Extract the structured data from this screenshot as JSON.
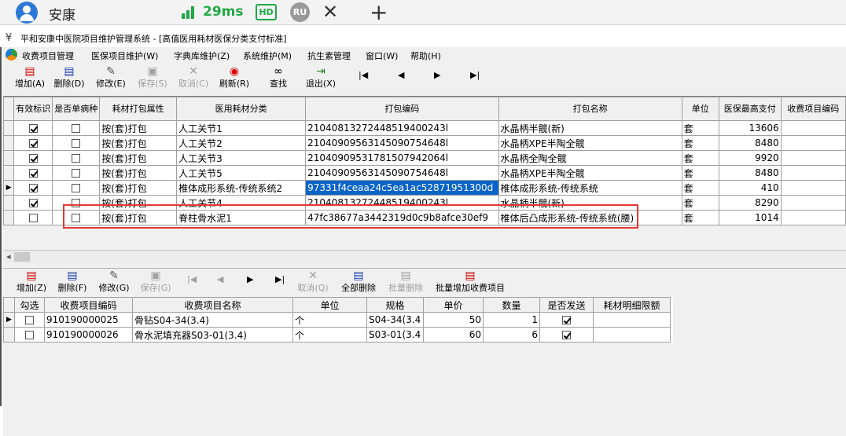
{
  "session": {
    "user": "安康",
    "ping": "29ms",
    "hd_badge": "HD",
    "ru_badge": "RU",
    "close_glyph": "✕",
    "new_tab_glyph": "+"
  },
  "window": {
    "title": "平和安康中医院项目维护管理系统 - [高值医用耗材医保分类支付标准]"
  },
  "menu": {
    "items": [
      "收费项目管理",
      "医保项目维护(W)",
      "字典库维护(Z)",
      "系统维护(M)",
      "抗生素管理",
      "窗口(W)",
      "帮助(H)"
    ]
  },
  "toolbar": {
    "buttons": [
      {
        "label": "增加(A)",
        "icon": "add-icon",
        "enabled": true
      },
      {
        "label": "删除(D)",
        "icon": "delete-icon",
        "enabled": true
      },
      {
        "label": "修改(E)",
        "icon": "edit-icon",
        "enabled": true
      },
      {
        "label": "保存(S)",
        "icon": "save-icon",
        "enabled": false
      },
      {
        "label": "取消(C)",
        "icon": "cancel-icon",
        "enabled": false
      },
      {
        "label": "刷新(R)",
        "icon": "refresh-icon",
        "enabled": true
      },
      {
        "label": "查找",
        "icon": "binoculars-icon",
        "enabled": true
      },
      {
        "label": "退出(X)",
        "icon": "exit-icon",
        "enabled": true
      }
    ],
    "nav": [
      "|◀",
      "◀",
      "▶",
      "▶|"
    ]
  },
  "grid1": {
    "columns": [
      "有效标识",
      "是否单病种",
      "耗材打包属性",
      "医用耗材分类",
      "打包编码",
      "打包名称",
      "单位",
      "医保最高支付",
      "收费项目编码"
    ],
    "rows": [
      {
        "valid": true,
        "single": false,
        "attr": "按(套)打包",
        "category": "人工关节1",
        "code": "21040813272448519400243l",
        "name": "水晶柄半髋(新)",
        "unit": "套",
        "max_pay": "13606",
        "fee_code": ""
      },
      {
        "valid": true,
        "single": false,
        "attr": "按(套)打包",
        "category": "人工关节2",
        "code": "21040909563145090754648l",
        "name": "水晶柄XPE半陶全髋",
        "unit": "套",
        "max_pay": "8480",
        "fee_code": ""
      },
      {
        "valid": true,
        "single": false,
        "attr": "按(套)打包",
        "category": "人工关节3",
        "code": "21040909531781507942064l",
        "name": "水晶柄全陶全髋",
        "unit": "套",
        "max_pay": "9920",
        "fee_code": ""
      },
      {
        "valid": true,
        "single": false,
        "attr": "按(套)打包",
        "category": "人工关节5",
        "code": "21040909563145090754648l",
        "name": "水晶柄XPE半陶全髋",
        "unit": "套",
        "max_pay": "8480",
        "fee_code": ""
      },
      {
        "valid": true,
        "single": false,
        "attr": "按(套)打包",
        "category": "椎体成形系统-传统系统2",
        "code": "97331f4ceaa24c5ea1ac52871951300d",
        "name": "椎体成形系统-传统系统",
        "unit": "套",
        "max_pay": "410",
        "fee_code": "",
        "current": true
      },
      {
        "valid": true,
        "single": false,
        "attr": "按(套)打包",
        "category": "人工关节4",
        "code": "21040813272448519400243l",
        "name": "水晶柄半髋(新)",
        "unit": "套",
        "max_pay": "8290",
        "fee_code": ""
      },
      {
        "valid": false,
        "single": false,
        "attr": "按(套)打包",
        "category": "脊柱骨水泥1",
        "code": "47fc38677a3442319d0c9b8afce30ef9",
        "name": "椎体后凸成形系统-传统系统(腰)",
        "unit": "套",
        "max_pay": "1014",
        "fee_code": ""
      }
    ]
  },
  "toolbar2": {
    "buttons": [
      {
        "label": "增加(Z)",
        "icon": "add-icon",
        "enabled": true
      },
      {
        "label": "删除(F)",
        "icon": "delete-icon",
        "enabled": true
      },
      {
        "label": "修改(G)",
        "icon": "edit-icon",
        "enabled": true
      },
      {
        "label": "保存(G)",
        "icon": "save-icon",
        "enabled": false
      },
      {
        "label": "取消(Q)",
        "icon": "cancel-icon",
        "enabled": false
      },
      {
        "label": "全部删除",
        "icon": "delete-all-icon",
        "enabled": true
      },
      {
        "label": "批量删除",
        "icon": "batch-delete-icon",
        "enabled": false
      },
      {
        "label": "批量增加收费项目",
        "icon": "batch-add-icon",
        "enabled": true
      }
    ],
    "nav": [
      "|◀",
      "◀",
      "▶",
      "▶|"
    ]
  },
  "grid2": {
    "columns": [
      "勾选",
      "收费项目编码",
      "收费项目名称",
      "单位",
      "规格",
      "单价",
      "数量",
      "是否发送",
      "耗材明细限额"
    ],
    "rows": [
      {
        "checked": false,
        "code": "910190000025",
        "name": "骨钻S04-34(3.4)",
        "unit": "个",
        "spec": "S04-34(3.4",
        "price": "50",
        "qty": "1",
        "send": true,
        "limit": ""
      },
      {
        "checked": false,
        "code": "910190000026",
        "name": "骨水泥填充器S03-01(3.4)",
        "unit": "个",
        "spec": "S03-01(3.4",
        "price": "60",
        "qty": "6",
        "send": true,
        "limit": ""
      }
    ]
  },
  "colors": {
    "selection": "#0a64c8",
    "highlight_box": "#e53935",
    "ping_green": "#22a845"
  }
}
